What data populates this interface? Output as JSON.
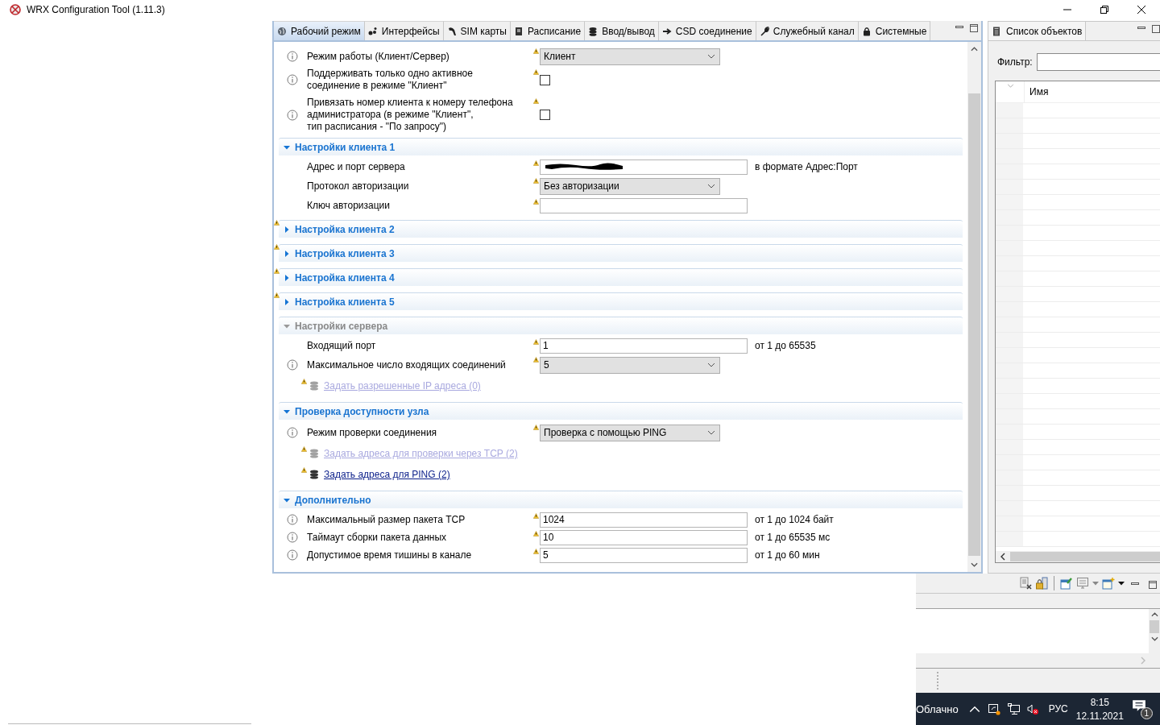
{
  "window": {
    "title": "WRX Configuration Tool (1.11.3)"
  },
  "tabs": [
    {
      "label": "Рабочий режим",
      "selected": true
    },
    {
      "label": "Интерфейсы",
      "selected": false
    },
    {
      "label": "SIM карты",
      "selected": false
    },
    {
      "label": "Расписание",
      "selected": false
    },
    {
      "label": "Ввод/вывод",
      "selected": false
    },
    {
      "label": "CSD соединение",
      "selected": false
    },
    {
      "label": "Служебный канал",
      "selected": false
    },
    {
      "label": "Системные",
      "selected": false
    }
  ],
  "top_rows": [
    {
      "kind": "select",
      "info": true,
      "label": "Режим работы (Клиент/Сервер)",
      "value": "Клиент"
    },
    {
      "kind": "checkbox",
      "info": true,
      "label": "Поддерживать только одно активное\nсоединение в режиме \"Клиент\"",
      "checked": false
    },
    {
      "kind": "checkbox",
      "info": true,
      "label": "Привязать номер клиента к номеру телефона\nадминистратора (в режиме \"Клиент\",\nтип расписания - \"По запросу\")",
      "checked": false
    }
  ],
  "sections": [
    {
      "title": "Настройки клиента 1",
      "expanded": true,
      "disabled": false,
      "warning": false,
      "rows": [
        {
          "kind": "text",
          "info": false,
          "label": "Адрес и порт сервера",
          "redacted": true,
          "hint": "в формате Адрес:Порт"
        },
        {
          "kind": "select",
          "info": false,
          "label": "Протокол авторизации",
          "value": "Без авторизации"
        },
        {
          "kind": "text",
          "info": false,
          "label": "Ключ авторизации",
          "redacted": false
        }
      ]
    },
    {
      "title": "Настройка клиента 2",
      "expanded": false,
      "disabled": false,
      "warning": true
    },
    {
      "title": "Настройка клиента 3",
      "expanded": false,
      "disabled": false,
      "warning": true
    },
    {
      "title": "Настройка клиента 4",
      "expanded": false,
      "disabled": false,
      "warning": true
    },
    {
      "title": "Настройка клиента 5",
      "expanded": false,
      "disabled": false,
      "warning": true
    },
    {
      "title": "Настройки сервера",
      "expanded": true,
      "disabled": true,
      "warning": false,
      "rows": [
        {
          "kind": "text",
          "info": false,
          "label": "Входящий порт",
          "value": "1",
          "redacted": false,
          "hint": "от 1 до 65535"
        },
        {
          "kind": "select",
          "info": true,
          "label": "Максимальное число входящих соединений",
          "value": "5"
        },
        {
          "kind": "link",
          "label": "Задать разрешенные IP адреса (0)",
          "disabled": true
        }
      ]
    },
    {
      "title": "Проверка доступности узла",
      "expanded": true,
      "disabled": false,
      "warning": false,
      "rows": [
        {
          "kind": "select",
          "info": true,
          "label": "Режим проверки соединения",
          "value": "Проверка с помощью PING"
        },
        {
          "kind": "link",
          "label": "Задать адреса для проверки через TCP  (2)",
          "disabled": true
        },
        {
          "kind": "link",
          "label": "Задать адреса для PING (2)",
          "disabled": false
        }
      ]
    },
    {
      "title": "Дополнительно",
      "expanded": true,
      "disabled": false,
      "warning": false,
      "rows": [
        {
          "kind": "text",
          "info": true,
          "label": "Максимальный размер пакета TCP",
          "value": "1024",
          "redacted": false,
          "hint": "от 1 до 1024 байт"
        },
        {
          "kind": "text",
          "info": true,
          "label": "Таймаут сборки пакета данных",
          "value": "10",
          "redacted": false,
          "hint": "от 1 до 65535 мс"
        },
        {
          "kind": "text",
          "info": true,
          "label": "Допустимое время тишины в канале",
          "value": "5",
          "redacted": false,
          "hint": "от 1 до 60 мин"
        }
      ]
    }
  ],
  "objects_panel": {
    "tab": {
      "label": "Список объектов"
    },
    "filter_label": "Фильтр:",
    "column": "Имя"
  },
  "taskbar": {
    "weather": "Облачно",
    "language": "РУС",
    "time": "8:15",
    "date": "12.11.2021",
    "notifications": "1"
  }
}
